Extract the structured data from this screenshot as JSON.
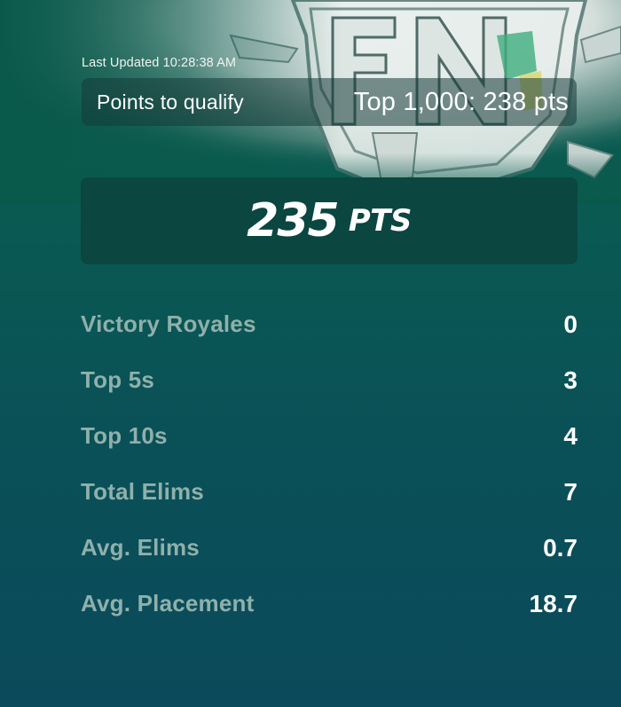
{
  "header": {
    "last_updated": "Last Updated 10:28:38 AM",
    "qualify_label": "Points to qualify",
    "qualify_value": "Top 1,000: 238 pts"
  },
  "points": {
    "value": "235",
    "unit": "PTS"
  },
  "stats": [
    {
      "label": "Victory Royales",
      "value": "0"
    },
    {
      "label": "Top 5s",
      "value": "3"
    },
    {
      "label": "Top 10s",
      "value": "4"
    },
    {
      "label": "Total Elims",
      "value": "7"
    },
    {
      "label": "Avg. Elims",
      "value": "0.7"
    },
    {
      "label": "Avg. Placement",
      "value": "18.7"
    }
  ],
  "icons": {
    "hero_art": "event-logo-artwork"
  },
  "colors": {
    "background_top": "#0a5a4c",
    "background_bottom": "#0b4a5b",
    "stat_label": "#8fb0ab",
    "card": "#0b4640"
  }
}
